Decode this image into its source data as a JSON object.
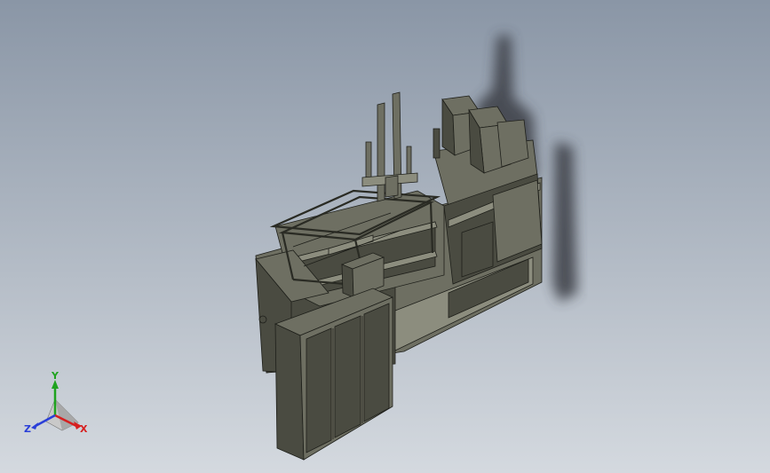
{
  "viewport": {
    "background_top": "#8a96a6",
    "background_bottom": "#d4d9df",
    "model_color": "#6e6f62",
    "model_dark": "#4a4b41",
    "model_light": "#8c8d7e",
    "shadow_color": "#3a3d45"
  },
  "triad": {
    "x_label": "X",
    "y_label": "Y",
    "z_label": "Z",
    "x_color": "#d62020",
    "y_color": "#1fa31f",
    "z_color": "#2a3fd8"
  }
}
